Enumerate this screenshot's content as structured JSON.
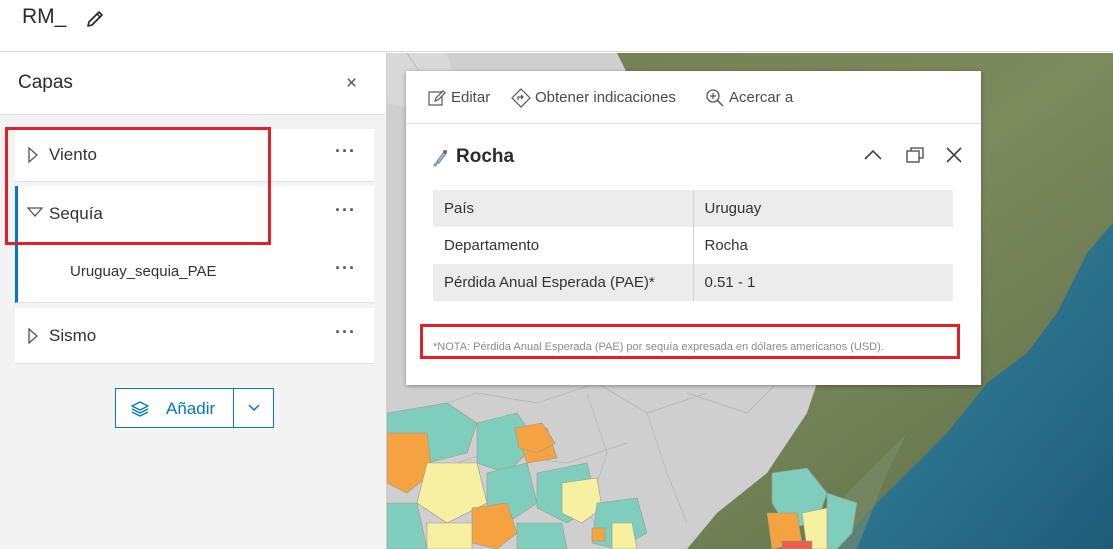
{
  "app": {
    "title": "RM_"
  },
  "layers_panel": {
    "title": "Capas",
    "close_symbol": "×",
    "layers": [
      {
        "name": "Viento",
        "expanded": false
      },
      {
        "name": "Sequía",
        "expanded": true,
        "sublayers": [
          "Uruguay_sequia_PAE"
        ]
      },
      {
        "name": "Sismo",
        "expanded": false
      }
    ],
    "more_symbol": "···",
    "add_button": {
      "label": "Añadir"
    }
  },
  "popup": {
    "actions": {
      "edit": "Editar",
      "directions": "Obtener indicaciones",
      "zoom": "Acercar a"
    },
    "title": "Rocha",
    "rows": [
      {
        "key": "País",
        "value": "Uruguay"
      },
      {
        "key": "Departamento",
        "value": "Rocha"
      },
      {
        "key": "Pérdida Anual Esperada (PAE)*",
        "value": "0.51 - 1"
      }
    ],
    "note": "*NOTA: Pérdida Anual Esperada (PAE) por sequía expresada en dólares americanos (USD)."
  },
  "colors": {
    "accent": "#0079c1",
    "highlight": "#e0202a",
    "class_teal": "#7fcdbb",
    "class_yellow": "#f7f0a0",
    "class_orange": "#f5a340",
    "class_red": "#e8604a",
    "ocean": "#2c6f8e"
  }
}
